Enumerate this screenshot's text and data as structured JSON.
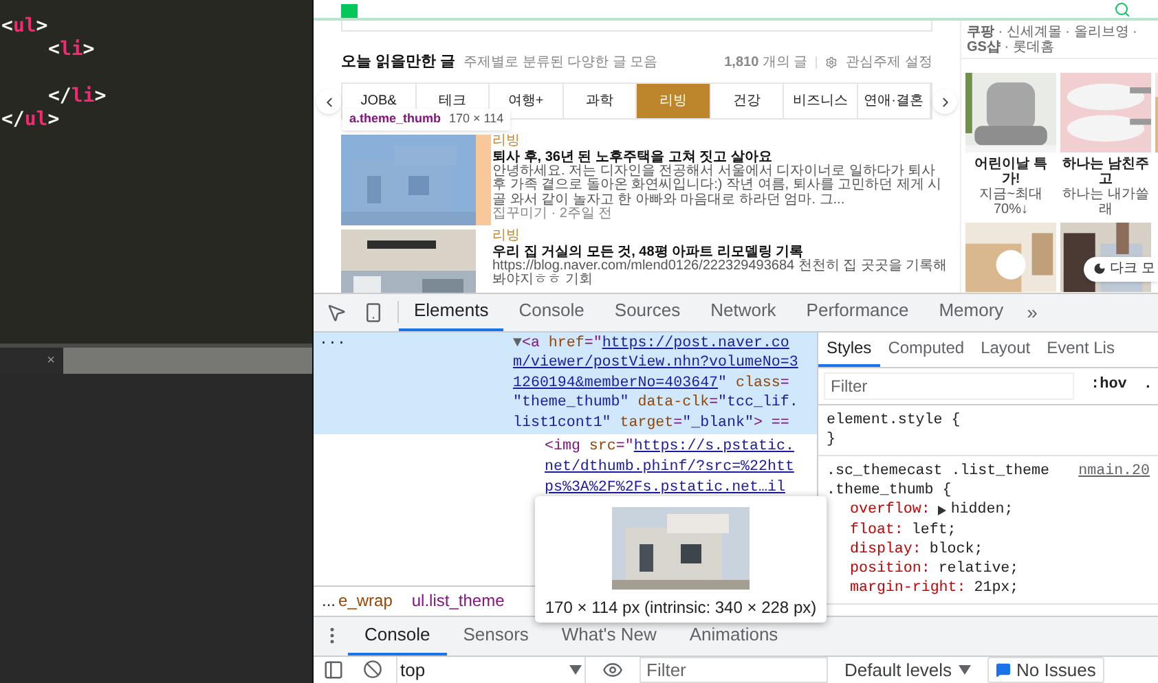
{
  "editor": {
    "tree": {
      "open": [
        {
          "kind": "punct",
          "text": "<"
        },
        {
          "kind": "tag",
          "text": "ul"
        },
        {
          "kind": "punct",
          "text": ">"
        }
      ],
      "close": [
        {
          "kind": "punct",
          "text": "</"
        },
        {
          "kind": "tag",
          "text": "ul"
        },
        {
          "kind": "punct",
          "text": ">"
        }
      ],
      "children": [
        {
          "open": [
            {
              "kind": "punct",
              "text": "<"
            },
            {
              "kind": "tag",
              "text": "li"
            },
            {
              "kind": "punct",
              "text": ">"
            }
          ],
          "close": [
            {
              "kind": "punct",
              "text": "</"
            },
            {
              "kind": "tag",
              "text": "li"
            },
            {
              "kind": "punct",
              "text": ">"
            }
          ]
        }
      ]
    },
    "tab": {
      "close": "×"
    }
  },
  "page": {
    "section": {
      "title": "오늘 읽을만한 글",
      "subtitle": "주제별로 분류된 다양한 글 모음",
      "count": "**1,810** 개의 글",
      "settings": "관심주제 설정"
    },
    "tabs": [
      {
        "label": "JOB&",
        "selected": false
      },
      {
        "label": "테크",
        "selected": false
      },
      {
        "label": "여행+",
        "selected": false
      },
      {
        "label": "과학",
        "selected": false
      },
      {
        "label": "리빙",
        "selected": true
      },
      {
        "label": "건강",
        "selected": false
      },
      {
        "label": "비즈니스",
        "selected": false
      },
      {
        "label": "연애·결혼",
        "selected": false
      }
    ],
    "inspect_tooltip": {
      "selector": "a.theme_thumb",
      "size": "170 × 114"
    },
    "articles": [
      {
        "highlighted": true,
        "category": "리빙",
        "title": "퇴사 후, 36년 된 노후주택을 고쳐 짓고 살아요",
        "description": "안녕하세요. 저는 디자인을 전공해서 서울에서 디자이너로 일하다가 퇴사 후 가족 곁으로 돌아온 화연씨입니다:) 작년 여름, 퇴사를 고민하던 제게 시골 와서 같이 놀자고 한 아빠와 마음대로 하라던 엄마. 그...",
        "meta": "집꾸미기 · 2주일 전"
      },
      {
        "highlighted": false,
        "category": "리빙",
        "title": "우리 집 거실의 모든 것, 48평 아파트 리모델링 기록",
        "description": "https://blog.naver.com/mlend0126/222329493684 천천히 집 곳곳을 기록해 봐야지ㅎㅎ 기회"
      }
    ],
    "shops": "**쿠팡** · 신세계몰 · 올리브영 · **GS샵** · 롯데홈",
    "products": [
      {
        "title": "어린이날 특가!",
        "subtitle": "지금~최대70%↓"
      },
      {
        "title": "하나는 남친주고",
        "subtitle": "하나는 내가쓸래"
      }
    ],
    "dark_mode": "다크 모"
  },
  "devtools": {
    "tabs": [
      {
        "label": "Elements",
        "selected": true
      },
      {
        "label": "Console",
        "selected": false
      },
      {
        "label": "Sources",
        "selected": false
      },
      {
        "label": "Network",
        "selected": false
      },
      {
        "label": "Performance",
        "selected": false
      },
      {
        "label": "Memory",
        "selected": false
      }
    ],
    "more": "»",
    "dom": {
      "selected": true,
      "ellipsis": "...",
      "lines": [
        [
          {
            "kind": "arrow",
            "text": "▼"
          },
          {
            "kind": "punct",
            "text": "<"
          },
          {
            "kind": "tag",
            "text": "a"
          },
          {
            "kind": "attr",
            "text": " href"
          },
          {
            "kind": "punct",
            "text": "=\""
          },
          {
            "kind": "link",
            "text": "https://post.naver.co"
          }
        ],
        [
          {
            "kind": "link",
            "text": "m/viewer/postView.nhn?volumeNo=3"
          }
        ],
        [
          {
            "kind": "link",
            "text": "1260194&memberNo=403647"
          },
          {
            "kind": "value",
            "text": "\""
          },
          {
            "kind": "attr",
            "text": " class"
          },
          {
            "kind": "punct",
            "text": "="
          }
        ],
        [
          {
            "kind": "value",
            "text": "\"theme_thumb\""
          },
          {
            "kind": "attr",
            "text": " data-clk"
          },
          {
            "kind": "punct",
            "text": "="
          },
          {
            "kind": "value",
            "text": "\"tcc_lif."
          }
        ],
        [
          {
            "kind": "value",
            "text": "list1cont1\""
          },
          {
            "kind": "attr",
            "text": " target"
          },
          {
            "kind": "punct",
            "text": "="
          },
          {
            "kind": "value",
            "text": "\"_blank\""
          },
          {
            "kind": "punct",
            "text": "> =="
          }
        ]
      ],
      "children": [
        {
          "selected": false,
          "lines": [
            [
              {
                "kind": "punct",
                "text": "<"
              },
              {
                "kind": "tag",
                "text": "img"
              },
              {
                "kind": "attr",
                "text": " src"
              },
              {
                "kind": "punct",
                "text": "=\""
              },
              {
                "kind": "link",
                "text": "https://s.pstatic."
              }
            ],
            [
              {
                "kind": "link",
                "text": "net/dthumb.phinf/?src=%22htt"
              }
            ],
            [
              {
                "kind": "link",
                "text": "ps%3A%2F%2Fs.pstatic.net…il"
              }
            ]
          ]
        }
      ]
    },
    "breadcrumbs": [
      {
        "kind": "more",
        "text": "..."
      },
      {
        "kind": "class",
        "text": "e_wrap"
      },
      {
        "kind": "tag",
        "text": "ul.list_theme"
      }
    ],
    "styles_tabs": [
      {
        "label": "Styles",
        "selected": true
      },
      {
        "label": "Computed",
        "selected": false
      },
      {
        "label": "Layout",
        "selected": false
      },
      {
        "label": "Event Lis",
        "selected": false
      }
    ],
    "styles_filter": {
      "placeholder": "Filter"
    },
    "hov": ":hov",
    "cls": ".",
    "rules": [
      {
        "selector": [
          "element.style {"
        ],
        "close": "}"
      },
      {
        "selector": [
          ".sc_themecast .list_theme",
          ".theme_thumb {"
        ],
        "source": "nmain.20",
        "declarations": [
          {
            "property": "overflow:",
            "value": "hidden;",
            "expandable": true
          },
          {
            "property": "float:",
            "value": "left;",
            "expandable": false
          },
          {
            "property": "display:",
            "value": "block;",
            "expandable": false
          },
          {
            "property": "position:",
            "value": "relative;",
            "expandable": false
          },
          {
            "property": "margin-right:",
            "value": "21px;",
            "expandable": false
          }
        ]
      }
    ],
    "image_tooltip": {
      "size": "170 × 114 px (intrinsic: 340 × 228 px)"
    },
    "drawer_tabs": [
      {
        "label": "Console",
        "selected": true
      },
      {
        "label": "Sensors",
        "selected": false
      },
      {
        "label": "What's New",
        "selected": false
      },
      {
        "label": "Animations",
        "selected": false
      }
    ],
    "console": {
      "context": "top",
      "filter": {
        "placeholder": "Filter"
      },
      "levels": "Default levels",
      "issues": "No Issues"
    }
  }
}
